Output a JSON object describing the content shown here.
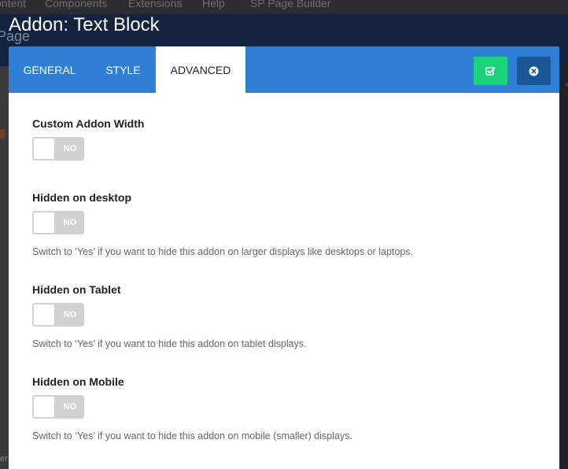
{
  "background": {
    "menu": [
      "ontent",
      "Components",
      "Extensions",
      "Help",
      "SP Page Builder"
    ],
    "page_word": "Page",
    "side_text": "er",
    "chevron": "›"
  },
  "modal": {
    "title": "Addon: Text Block",
    "tabs": [
      {
        "label": "GENERAL",
        "active": false
      },
      {
        "label": "STYLE",
        "active": false
      },
      {
        "label": "ADVANCED",
        "active": true
      }
    ],
    "apply_icon": "check-square-icon",
    "close_icon": "close-circle-icon"
  },
  "fields": [
    {
      "label": "Custom Addon Width",
      "value": "NO",
      "help": ""
    },
    {
      "label": "Hidden on desktop",
      "value": "NO",
      "help": "Switch to ‘Yes’ if you want to hide this addon on larger displays like desktops or laptops."
    },
    {
      "label": "Hidden on Tablet",
      "value": "NO",
      "help": "Switch to ‘Yes’ if you want to hide this addon on tablet displays."
    },
    {
      "label": "Hidden on Mobile",
      "value": "NO",
      "help": "Switch to ‘Yes’ if you want to hide this addon on mobile (smaller) displays."
    }
  ],
  "colors": {
    "tab_bar": "#2f7fd6",
    "apply_button": "#1bd47a",
    "close_button": "#1a5596",
    "toggle_off": "#d1d1d1"
  }
}
